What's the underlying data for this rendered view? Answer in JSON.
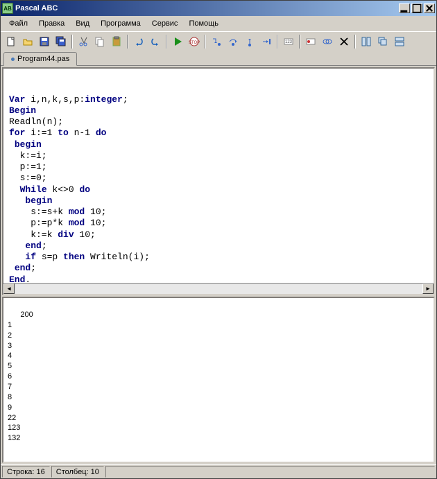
{
  "title": "Pascal ABC",
  "menu": [
    "Файл",
    "Правка",
    "Вид",
    "Программа",
    "Сервис",
    "Помощь"
  ],
  "tab": {
    "label": "Program44.pas"
  },
  "code_tokens": [
    [
      [
        "kw",
        "Var"
      ],
      [
        "plain",
        " i,n,k,s,p:"
      ],
      [
        "kw",
        "integer"
      ],
      [
        "plain",
        ";"
      ]
    ],
    [
      [
        "kw",
        "Begin"
      ]
    ],
    [
      [
        "plain",
        "Readln(n);"
      ]
    ],
    [
      [
        "kw",
        "for"
      ],
      [
        "plain",
        " i:=1 "
      ],
      [
        "kw",
        "to"
      ],
      [
        "plain",
        " n-1 "
      ],
      [
        "kw",
        "do"
      ]
    ],
    [
      [
        "plain",
        " "
      ],
      [
        "kw",
        "begin"
      ]
    ],
    [
      [
        "plain",
        "  k:=i;"
      ]
    ],
    [
      [
        "plain",
        "  p:=1;"
      ]
    ],
    [
      [
        "plain",
        "  s:=0;"
      ]
    ],
    [
      [
        "plain",
        "  "
      ],
      [
        "kw",
        "While"
      ],
      [
        "plain",
        " k<>0 "
      ],
      [
        "kw",
        "do"
      ]
    ],
    [
      [
        "plain",
        "   "
      ],
      [
        "kw",
        "begin"
      ]
    ],
    [
      [
        "plain",
        "    s:=s+k "
      ],
      [
        "kw",
        "mod"
      ],
      [
        "plain",
        " 10;"
      ]
    ],
    [
      [
        "plain",
        "    p:=p*k "
      ],
      [
        "kw",
        "mod"
      ],
      [
        "plain",
        " 10;"
      ]
    ],
    [
      [
        "plain",
        "    k:=k "
      ],
      [
        "kw",
        "div"
      ],
      [
        "plain",
        " 10;"
      ]
    ],
    [
      [
        "plain",
        "   "
      ],
      [
        "kw",
        "end"
      ],
      [
        "plain",
        ";"
      ]
    ],
    [
      [
        "plain",
        "   "
      ],
      [
        "kw",
        "if"
      ],
      [
        "plain",
        " s=p "
      ],
      [
        "kw",
        "then"
      ],
      [
        "plain",
        " Writeln(i);"
      ]
    ],
    [
      [
        "plain",
        " "
      ],
      [
        "kw",
        "end"
      ],
      [
        "plain",
        ";"
      ]
    ],
    [
      [
        "kw",
        "End"
      ],
      [
        "plain",
        "."
      ]
    ]
  ],
  "output": "200\n1\n2\n3\n4\n5\n6\n7\n8\n9\n22\n123\n132",
  "status": {
    "line_label": "Строка:",
    "line": 16,
    "col_label": "Столбец:",
    "col": 10
  },
  "toolbar_icons": [
    "new-file-icon",
    "open-file-icon",
    "save-icon",
    "save-all-icon",
    "|",
    "cut-icon",
    "copy-icon",
    "paste-icon",
    "|",
    "undo-icon",
    "redo-icon",
    "|",
    "run-icon",
    "stop-icon",
    "|",
    "step-into-icon",
    "step-over-icon",
    "step-out-icon",
    "run-to-cursor-icon",
    "|",
    "watch-icon",
    "|",
    "breakpoint-icon",
    "breakpoints-icon",
    "close-icon",
    "|",
    "window-tile-icon",
    "window-cascade-icon",
    "window-arrange-icon"
  ]
}
